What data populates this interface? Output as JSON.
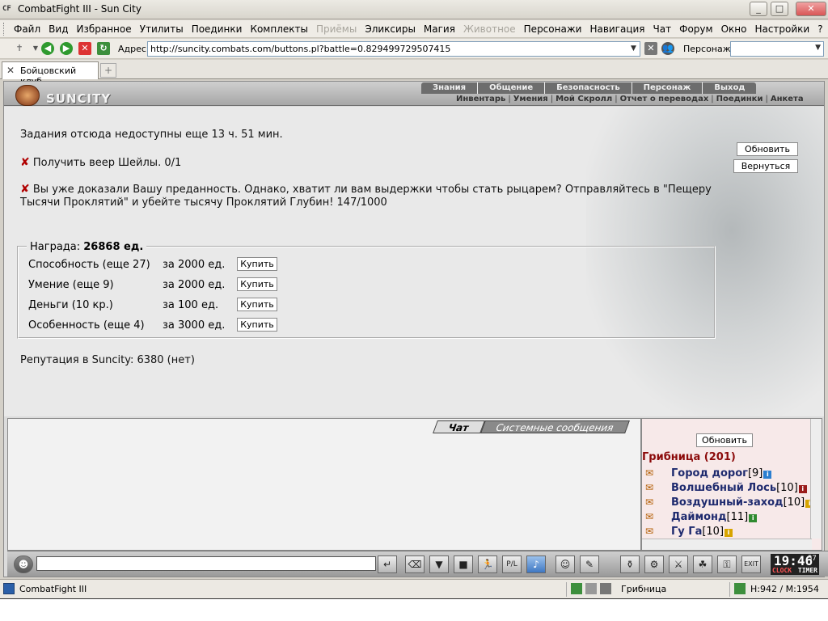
{
  "window": {
    "title": "CombatFight III - Sun City",
    "app_icon": "CF",
    "controls": [
      "minimize",
      "maximize",
      "close"
    ]
  },
  "menu": {
    "items": [
      {
        "label": "Файл",
        "enabled": true
      },
      {
        "label": "Вид",
        "enabled": true
      },
      {
        "label": "Избранное",
        "enabled": true
      },
      {
        "label": "Утилиты",
        "enabled": true
      },
      {
        "label": "Поединки",
        "enabled": true
      },
      {
        "label": "Комплекты",
        "enabled": true
      },
      {
        "label": "Приёмы",
        "enabled": false
      },
      {
        "label": "Эликсиры",
        "enabled": true
      },
      {
        "label": "Магия",
        "enabled": true
      },
      {
        "label": "Животное",
        "enabled": false
      },
      {
        "label": "Персонажи",
        "enabled": true
      },
      {
        "label": "Навигация",
        "enabled": true
      },
      {
        "label": "Чат",
        "enabled": true
      },
      {
        "label": "Форум",
        "enabled": true
      },
      {
        "label": "Окно",
        "enabled": true
      },
      {
        "label": "Настройки",
        "enabled": true
      },
      {
        "label": "?",
        "enabled": true
      }
    ]
  },
  "toolbar": {
    "address_label": "Адрес:",
    "address_value": "http://suncity.combats.com/buttons.pl?battle=0.829499729507415",
    "character_label": "Персонаж:",
    "character_value": ""
  },
  "tabs": {
    "active": "Бойцовский клуб",
    "new_tab": "+"
  },
  "game": {
    "logo_text": "SUNCITY",
    "nav_top": [
      "Знания",
      "Общение",
      "Безопасность",
      "Персонаж",
      "Выход"
    ],
    "nav_bottom": [
      "Инвентарь",
      "Умения",
      "Мой Скролл",
      "Отчет о переводах",
      "Поединки",
      "Анкета"
    ],
    "quest": {
      "cooldown_text": "Задания отсюда недоступны еще 13 ч. 51 мин.",
      "task1": "Получить веер Шейлы. 0/1",
      "task2_line1": "Вы уже доказали Вашу преданность. Однако, хватит ли вам выдержки чтобы стать рыцарем? Отправляйтесь в \"Пещеру",
      "task2_line2": "Тысячи Проклятий\" и убейте тысячу Проклятий Глубин! 147/1000",
      "refresh_button": "Обновить",
      "back_button": "Вернуться",
      "reward_label": "Награда:",
      "reward_value": "26868 ед.",
      "reward_rows": [
        {
          "label": "Способность (еще 27)",
          "price": "за 2000 ед.",
          "button": "Купить"
        },
        {
          "label": "Умение (еще 9)",
          "price": "за 2000 ед.",
          "button": "Купить"
        },
        {
          "label": "Деньги (10 кр.)",
          "price": "за 100 ед.",
          "button": "Купить"
        },
        {
          "label": "Особенность (еще 4)",
          "price": "за 3000 ед.",
          "button": "Купить"
        }
      ],
      "reputation_text": "Репутация в Suncity: 6380 (нет)"
    },
    "chat": {
      "tab_chat": "Чат",
      "tab_system": "Системные сообщения",
      "input_value": ""
    },
    "online": {
      "refresh_button": "Обновить",
      "room": "Грибница (201)",
      "players": [
        {
          "name": "Город дорог",
          "level": "[9]",
          "badge_color": "#2b7fd0"
        },
        {
          "name": "Волшебный Лось",
          "level": "[10]",
          "badge_color": "#9a1b1b"
        },
        {
          "name": "Воздушный-заход",
          "level": "[10]",
          "badge_color": "#d7a400"
        },
        {
          "name": "Даймонд",
          "level": "[11]",
          "badge_color": "#2f8a2f"
        },
        {
          "name": "Гу Га",
          "level": "[10]",
          "badge_color": "#d7a400"
        }
      ]
    },
    "clock": {
      "time": "19:46",
      "seconds": "57",
      "clock_label": "CLOCK",
      "timer_label": "TIMER"
    }
  },
  "statusbar": {
    "app_name": "CombatFight III",
    "location": "Грибница",
    "hp_mp": "H:942 / M:1954"
  }
}
